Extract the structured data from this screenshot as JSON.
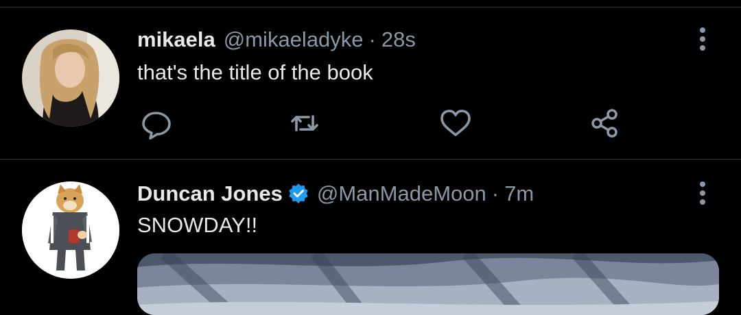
{
  "tweets": [
    {
      "name": "mikaela",
      "handle": "@mikaeladyke",
      "separator": "·",
      "time": "28s",
      "text": "that's the title of the book",
      "verified": false,
      "actions": [
        "reply-icon",
        "retweet-icon",
        "like-icon",
        "share-icon"
      ]
    },
    {
      "name": "Duncan Jones",
      "handle": "@ManMadeMoon",
      "separator": "·",
      "time": "7m",
      "text": "SNOWDAY!!",
      "verified": true
    }
  ],
  "colors": {
    "background": "#000000",
    "text_primary": "#e7e9ea",
    "text_secondary": "#8b98a5",
    "divider": "#2f3336",
    "verified": "#1d9bf0"
  }
}
